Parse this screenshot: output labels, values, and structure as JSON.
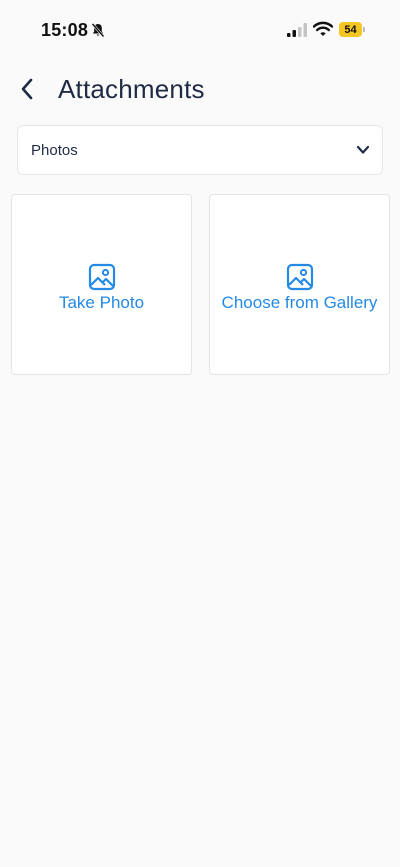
{
  "status_bar": {
    "time": "15:08",
    "battery_level": "54",
    "battery_color": "#f3c623"
  },
  "header": {
    "title": "Attachments",
    "back_icon": "chevron-left-icon"
  },
  "dropdown": {
    "selected": "Photos",
    "icon": "chevron-down-icon"
  },
  "tiles": [
    {
      "label": "Take Photo",
      "icon": "image-icon"
    },
    {
      "label": "Choose from Gallery",
      "icon": "image-icon"
    }
  ],
  "colors": {
    "accent": "#2589e6",
    "background": "#fafafa",
    "title_text": "#1f2a44"
  }
}
